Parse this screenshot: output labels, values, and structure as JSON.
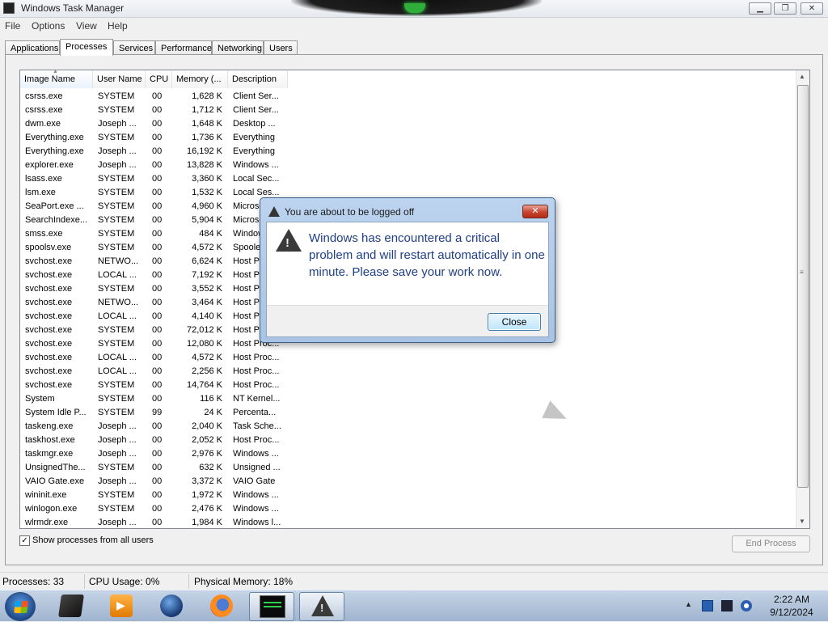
{
  "window": {
    "title": "Windows Task Manager"
  },
  "menu": [
    "File",
    "Options",
    "View",
    "Help"
  ],
  "tabs": [
    "Applications",
    "Processes",
    "Services",
    "Performance",
    "Networking",
    "Users"
  ],
  "active_tab": "Processes",
  "columns": [
    "Image Name",
    "User Name",
    "CPU",
    "Memory (...",
    "Description"
  ],
  "processes": [
    [
      "csrss.exe",
      "SYSTEM",
      "00",
      "1,628 K",
      "Client Ser..."
    ],
    [
      "csrss.exe",
      "SYSTEM",
      "00",
      "1,712 K",
      "Client Ser..."
    ],
    [
      "dwm.exe",
      "Joseph ...",
      "00",
      "1,648 K",
      "Desktop ..."
    ],
    [
      "Everything.exe",
      "SYSTEM",
      "00",
      "1,736 K",
      "Everything"
    ],
    [
      "Everything.exe",
      "Joseph ...",
      "00",
      "16,192 K",
      "Everything"
    ],
    [
      "explorer.exe",
      "Joseph ...",
      "00",
      "13,828 K",
      "Windows ..."
    ],
    [
      "lsass.exe",
      "SYSTEM",
      "00",
      "3,360 K",
      "Local Sec..."
    ],
    [
      "lsm.exe",
      "SYSTEM",
      "00",
      "1,532 K",
      "Local Ses..."
    ],
    [
      "SeaPort.exe ...",
      "SYSTEM",
      "00",
      "4,960 K",
      "Microso..."
    ],
    [
      "SearchIndexe...",
      "SYSTEM",
      "00",
      "5,904 K",
      "Microso..."
    ],
    [
      "smss.exe",
      "SYSTEM",
      "00",
      "484 K",
      "Window..."
    ],
    [
      "spoolsv.exe",
      "SYSTEM",
      "00",
      "4,572 K",
      "Spooler..."
    ],
    [
      "svchost.exe",
      "NETWO...",
      "00",
      "6,624 K",
      "Host Pr..."
    ],
    [
      "svchost.exe",
      "LOCAL ...",
      "00",
      "7,192 K",
      "Host Pr..."
    ],
    [
      "svchost.exe",
      "SYSTEM",
      "00",
      "3,552 K",
      "Host Pr..."
    ],
    [
      "svchost.exe",
      "NETWO...",
      "00",
      "3,464 K",
      "Host Pr..."
    ],
    [
      "svchost.exe",
      "LOCAL ...",
      "00",
      "4,140 K",
      "Host Pr..."
    ],
    [
      "svchost.exe",
      "SYSTEM",
      "00",
      "72,012 K",
      "Host Pr..."
    ],
    [
      "svchost.exe",
      "SYSTEM",
      "00",
      "12,080 K",
      "Host Proc..."
    ],
    [
      "svchost.exe",
      "LOCAL ...",
      "00",
      "4,572 K",
      "Host Proc..."
    ],
    [
      "svchost.exe",
      "LOCAL ...",
      "00",
      "2,256 K",
      "Host Proc..."
    ],
    [
      "svchost.exe",
      "SYSTEM",
      "00",
      "14,764 K",
      "Host Proc..."
    ],
    [
      "System",
      "SYSTEM",
      "00",
      "116 K",
      "NT Kernel..."
    ],
    [
      "System Idle P...",
      "SYSTEM",
      "99",
      "24 K",
      "Percenta..."
    ],
    [
      "taskeng.exe",
      "Joseph ...",
      "00",
      "2,040 K",
      "Task Sche..."
    ],
    [
      "taskhost.exe",
      "Joseph ...",
      "00",
      "2,052 K",
      "Host Proc..."
    ],
    [
      "taskmgr.exe",
      "Joseph ...",
      "00",
      "2,976 K",
      "Windows ..."
    ],
    [
      "UnsignedThe...",
      "SYSTEM",
      "00",
      "632 K",
      "Unsigned ..."
    ],
    [
      "VAIO Gate.exe",
      "Joseph ...",
      "00",
      "3,372 K",
      "VAIO Gate"
    ],
    [
      "wininit.exe",
      "SYSTEM",
      "00",
      "1,972 K",
      "Windows ..."
    ],
    [
      "winlogon.exe",
      "SYSTEM",
      "00",
      "2,476 K",
      "Windows ..."
    ],
    [
      "wlrmdr.exe",
      "Joseph ...",
      "00",
      "1,984 K",
      "Windows l..."
    ]
  ],
  "show_all_users": {
    "label": "Show processes from all users",
    "checked": true
  },
  "end_process_label": "End Process",
  "status": {
    "processes": "Processes: 33",
    "cpu": "CPU Usage: 0%",
    "memory": "Physical Memory: 18%"
  },
  "dialog": {
    "title": "You are about to be logged off",
    "message": "Windows has encountered a critical problem and will restart automatically in one minute. Please save your work now.",
    "close_label": "Close",
    "x_label": "✕"
  },
  "taskbar": {
    "apps": [
      "app-icon",
      "media-player-icon",
      "globe-icon",
      "firefox-icon",
      "task-manager-icon",
      "warning-icon"
    ],
    "clock_time": "2:22 AM",
    "clock_date": "9/12/2024"
  },
  "colors": {
    "dialog_text": "#1f3f87",
    "close_red": "#c7442f",
    "accent": "#3c7fb1"
  }
}
